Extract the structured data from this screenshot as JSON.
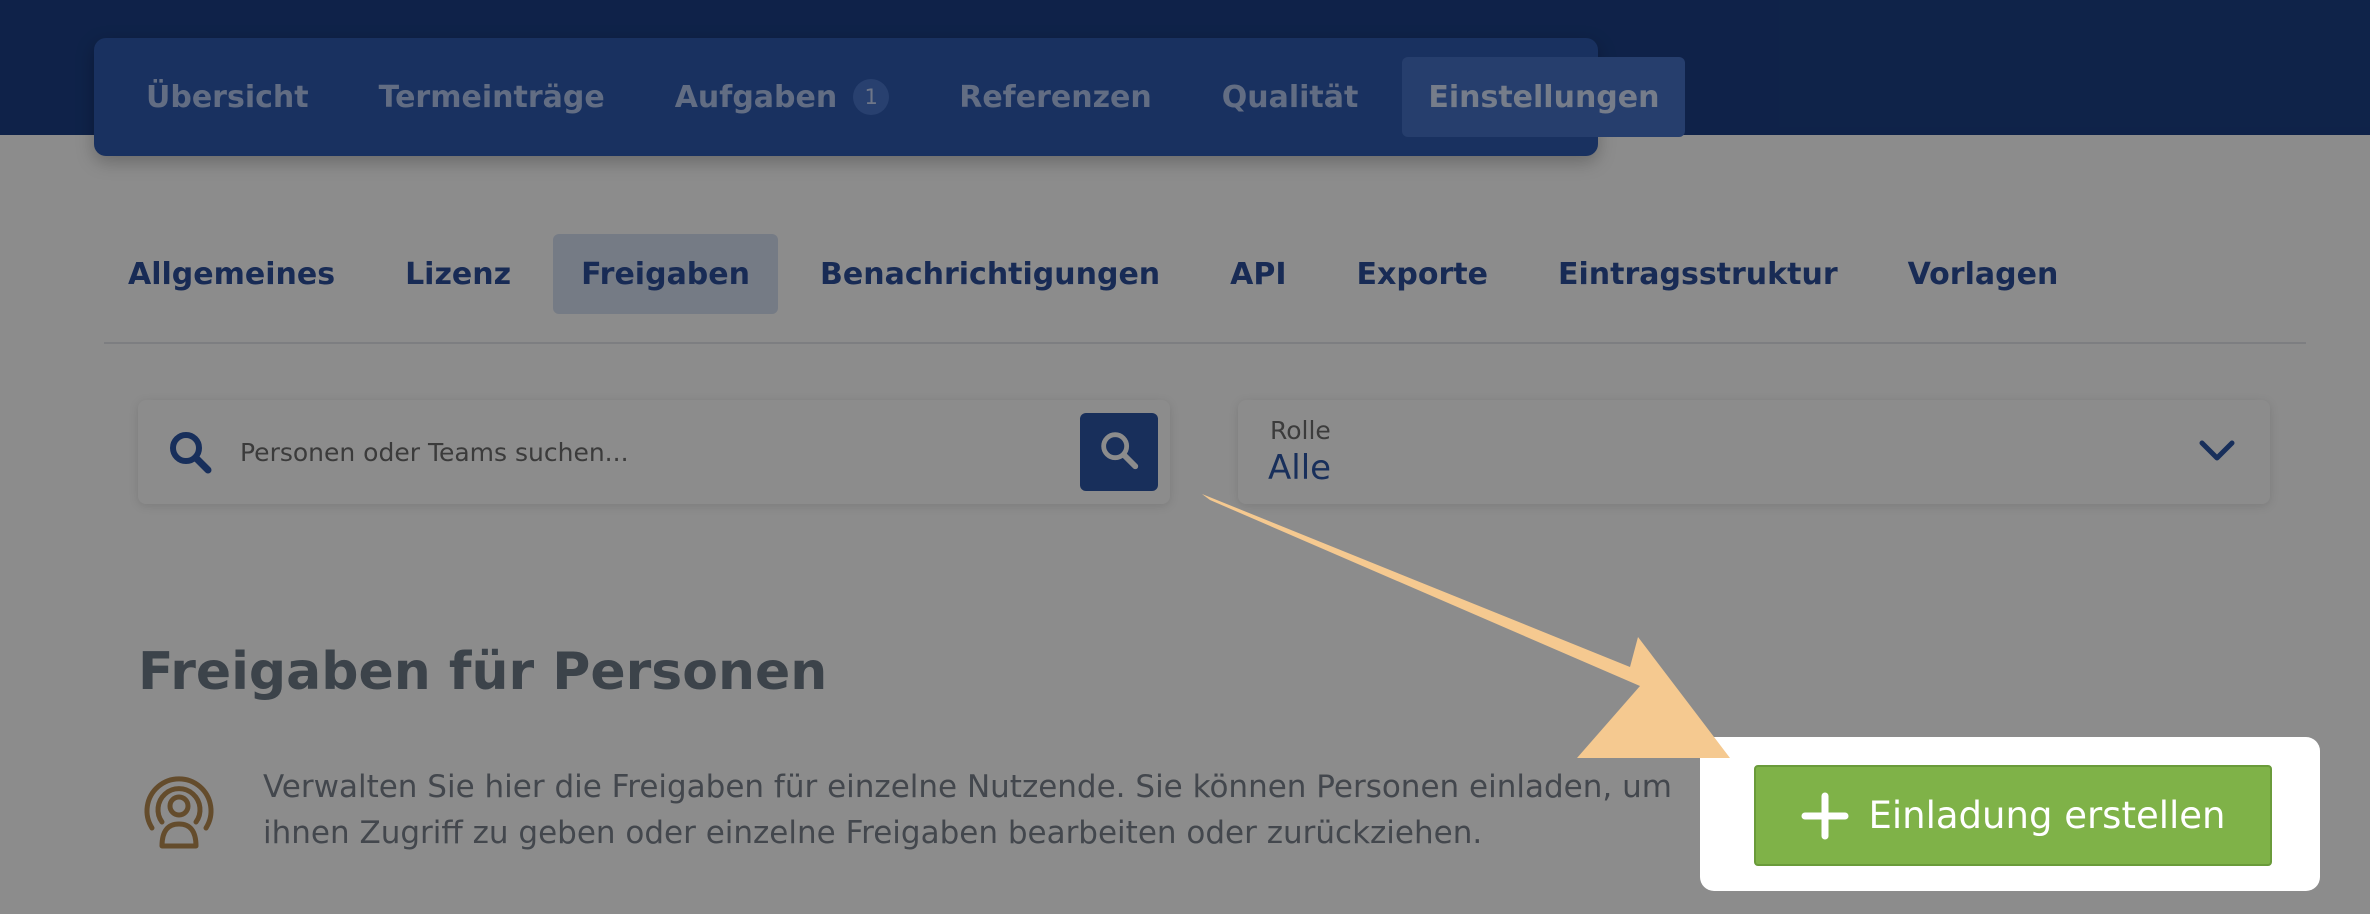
{
  "main_nav": {
    "items": [
      {
        "label": "Übersicht"
      },
      {
        "label": "Termeinträge"
      },
      {
        "label": "Aufgaben",
        "badge": "1"
      },
      {
        "label": "Referenzen"
      },
      {
        "label": "Qualität"
      },
      {
        "label": "Einstellungen",
        "active": true
      }
    ]
  },
  "sub_nav": {
    "items": [
      {
        "label": "Allgemeines"
      },
      {
        "label": "Lizenz"
      },
      {
        "label": "Freigaben",
        "active": true
      },
      {
        "label": "Benachrichtigungen"
      },
      {
        "label": "API"
      },
      {
        "label": "Exporte"
      },
      {
        "label": "Eintragsstruktur"
      },
      {
        "label": "Vorlagen"
      }
    ]
  },
  "search": {
    "placeholder": "Personen oder Teams suchen...",
    "value": ""
  },
  "role_filter": {
    "label": "Rolle",
    "value": "Alle"
  },
  "section": {
    "title": "Freigaben für Personen",
    "description": "Verwalten Sie hier die Freigaben für einzelne Nutzende. Sie können Personen einladen, um ihnen Zugriff zu geben oder einzelne Freigaben bearbeiten oder zurückziehen."
  },
  "invite_button": {
    "label": "Einladung erstellen"
  },
  "icons": {
    "search_left": "search-icon",
    "search_button": "search-icon",
    "role_chevron": "chevron-down-icon",
    "info": "person-broadcast-icon",
    "invite": "plus-icon"
  },
  "colors": {
    "topbar": "#1c3f85",
    "primary": "#2c56a7",
    "success": "#7fb248",
    "arrow": "#f5c990",
    "info_icon": "#b78a50"
  }
}
